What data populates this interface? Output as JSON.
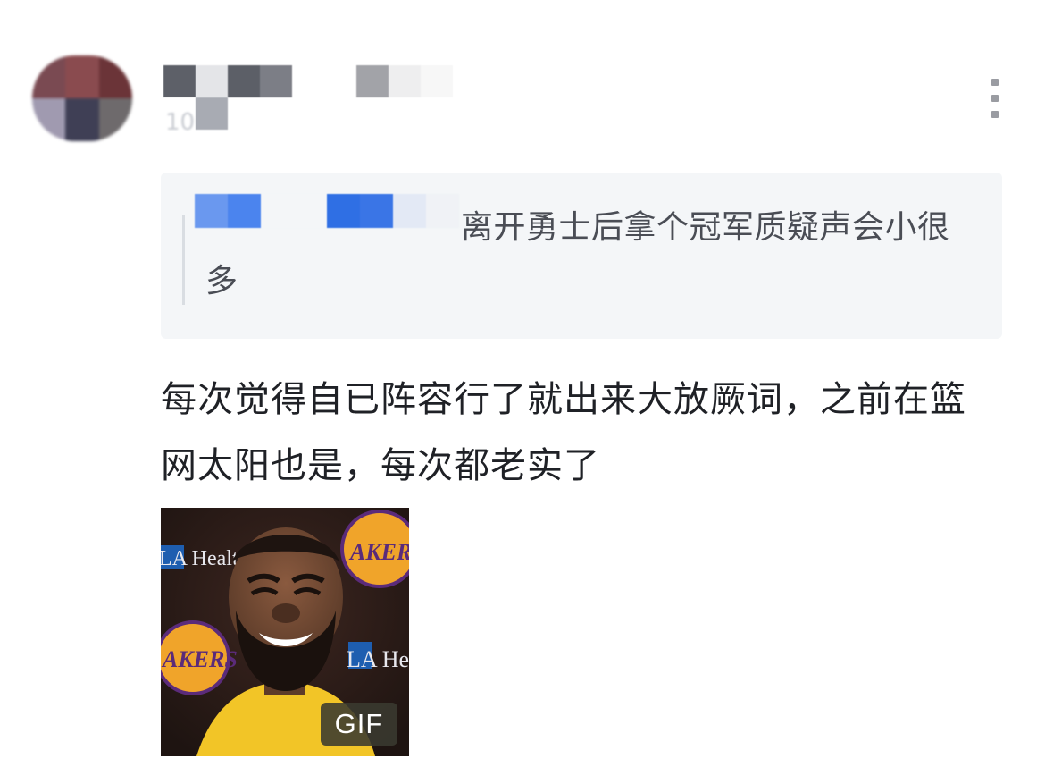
{
  "header": {
    "meta_text": "10"
  },
  "quote": {
    "text": "离开勇士后拿个冠军质疑声会小很多"
  },
  "comment": {
    "text": "每次觉得自已阵容行了就出来大放厥词，之前在篮网太阳也是，每次都老实了"
  },
  "gif": {
    "badge": "GIF",
    "sign_left": "LA Healt",
    "sign_right": "LA He",
    "logo_text_top": "AKERS",
    "logo_text_left": "AKERS"
  },
  "icons": {
    "more": "more-vertical-icon"
  },
  "colors": {
    "quote_bg": "#f4f6f8",
    "text_primary": "#1f2126",
    "text_secondary": "#4a4d55",
    "mention_blue": "#2f6fe4",
    "icon_gray": "#9a9ca2"
  }
}
